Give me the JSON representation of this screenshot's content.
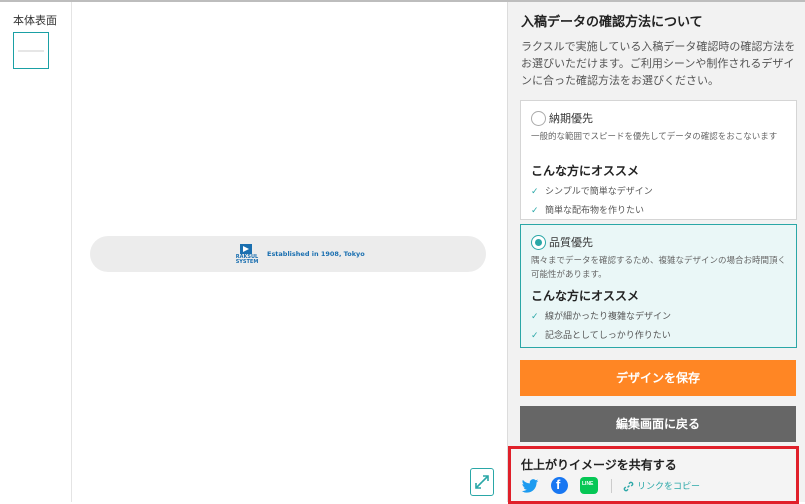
{
  "thumbnails": {
    "label": "本体表面"
  },
  "canvas": {
    "logo_text": "RAKSUL\nSYSTEM",
    "tagline": "Established in 1908, Tokyo"
  },
  "panel": {
    "title": "入稿データの確認方法について",
    "description": "ラクスルで実施している入稿データ確認時の確認方法をお選びいただけます。ご利用シーンや制作されるデザインに合った確認方法をお選びください。",
    "options": [
      {
        "title": "納期優先",
        "description": "一般的な範囲でスピードを優先してデータの確認をおこないます",
        "recommend_heading": "こんな方にオススメ",
        "points": [
          "シンプルで簡単なデザイン",
          "簡単な配布物を作りたい"
        ],
        "selected": false
      },
      {
        "title": "品質優先",
        "description": "隅々までデータを確認するため、複雑なデザインの場合お時間頂く可能性があります。",
        "recommend_heading": "こんな方にオススメ",
        "points": [
          "線が細かったり複雑なデザイン",
          "記念品としてしっかり作りたい"
        ],
        "selected": true
      }
    ],
    "save_button": "デザインを保存",
    "back_button": "編集画面に戻る"
  },
  "share": {
    "title": "仕上がりイメージを共有する",
    "icons": [
      "twitter-icon",
      "facebook-icon",
      "line-icon"
    ],
    "line_label": "LINE",
    "facebook_label": "f",
    "copy_link": "リンクをコピー"
  },
  "colors": {
    "accent": "#2aa7a7",
    "save": "#ff8624",
    "back": "#666666",
    "highlight_border": "#e0202a"
  }
}
